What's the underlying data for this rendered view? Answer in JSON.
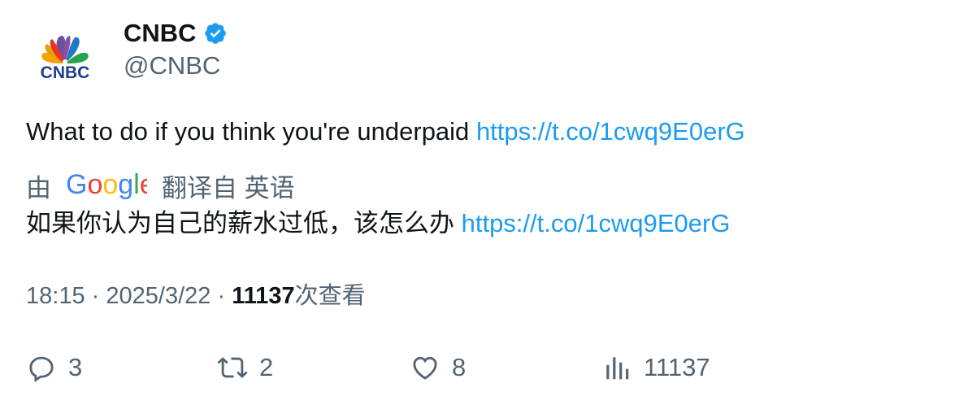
{
  "author": {
    "name": "CNBC",
    "handle": "@CNBC",
    "logo_text": "CNBC",
    "verified": true
  },
  "tweet": {
    "text": "What to do if you think you're underpaid",
    "link": "https://t.co/1cwq9E0erG"
  },
  "translation": {
    "prefix": "由",
    "provider": "Google",
    "suffix": "翻译自 英语",
    "text": "如果你认为自己的薪水过低，该怎么办",
    "link": "https://t.co/1cwq9E0erG"
  },
  "meta": {
    "time": "18:15",
    "separator": "·",
    "date": "2025/3/22",
    "views_count": "11137",
    "views_label": "次查看"
  },
  "actions": {
    "replies": "3",
    "retweets": "2",
    "likes": "8",
    "views": "11137"
  },
  "colors": {
    "link": "#1d9bf0",
    "secondary_text": "#536471",
    "verified": "#1d9bf0"
  }
}
